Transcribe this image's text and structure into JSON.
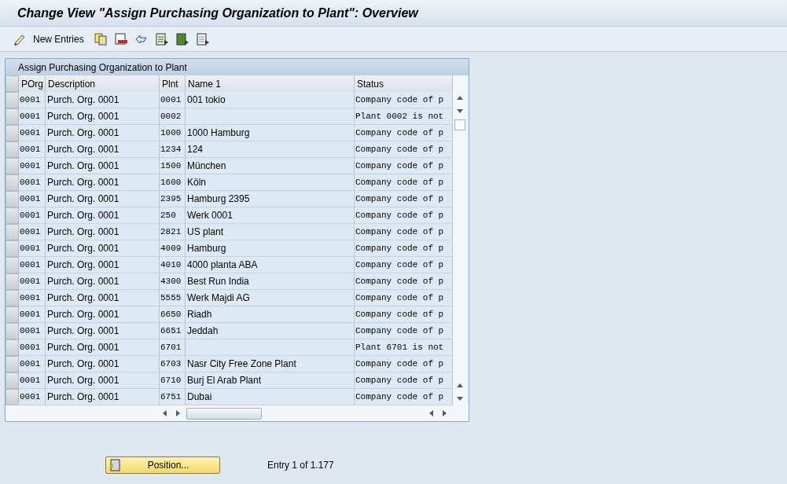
{
  "window": {
    "title": "Change View \"Assign Purchasing Organization to Plant\": Overview"
  },
  "toolbar": {
    "new_entries": "New Entries"
  },
  "table": {
    "title": "Assign Purchasing Organization to Plant",
    "columns": [
      "POrg",
      "Description",
      "Plnt",
      "Name 1",
      "Status"
    ],
    "rows": [
      {
        "porg": "0001",
        "description": "Purch. Org. 0001",
        "plant": "0001",
        "name": "001 tokio",
        "status": "Company code of p"
      },
      {
        "porg": "0001",
        "description": "Purch. Org. 0001",
        "plant": "0002",
        "name": "",
        "status": "Plant 0002 is not"
      },
      {
        "porg": "0001",
        "description": "Purch. Org. 0001",
        "plant": "1000",
        "name": "1000 Hamburg",
        "status": "Company code of p"
      },
      {
        "porg": "0001",
        "description": "Purch. Org. 0001",
        "plant": "1234",
        "name": "124",
        "status": "Company code of p"
      },
      {
        "porg": "0001",
        "description": "Purch. Org. 0001",
        "plant": "1500",
        "name": "München",
        "status": "Company code of p"
      },
      {
        "porg": "0001",
        "description": "Purch. Org. 0001",
        "plant": "1600",
        "name": "Köln",
        "status": "Company code of p"
      },
      {
        "porg": "0001",
        "description": "Purch. Org. 0001",
        "plant": "2395",
        "name": "Hamburg 2395",
        "status": "Company code of p"
      },
      {
        "porg": "0001",
        "description": "Purch. Org. 0001",
        "plant": "250",
        "name": "Werk 0001",
        "status": "Company code of p"
      },
      {
        "porg": "0001",
        "description": "Purch. Org. 0001",
        "plant": "2821",
        "name": "US plant",
        "status": "Company code of p"
      },
      {
        "porg": "0001",
        "description": "Purch. Org. 0001",
        "plant": "4009",
        "name": "Hamburg",
        "status": "Company code of p"
      },
      {
        "porg": "0001",
        "description": "Purch. Org. 0001",
        "plant": "4010",
        "name": "4000 planta ABA",
        "status": "Company code of p"
      },
      {
        "porg": "0001",
        "description": "Purch. Org. 0001",
        "plant": "4300",
        "name": "Best Run India",
        "status": "Company code of p"
      },
      {
        "porg": "0001",
        "description": "Purch. Org. 0001",
        "plant": "5555",
        "name": "Werk Majdi AG",
        "status": "Company code of p"
      },
      {
        "porg": "0001",
        "description": "Purch. Org. 0001",
        "plant": "6650",
        "name": "Riadh",
        "status": "Company code of p"
      },
      {
        "porg": "0001",
        "description": "Purch. Org. 0001",
        "plant": "6651",
        "name": "Jeddah",
        "status": "Company code of p"
      },
      {
        "porg": "0001",
        "description": "Purch. Org. 0001",
        "plant": "6701",
        "name": "",
        "status": "Plant 6701 is not"
      },
      {
        "porg": "0001",
        "description": "Purch. Org. 0001",
        "plant": "6703",
        "name": "Nasr City Free Zone Plant",
        "status": "Company code of p"
      },
      {
        "porg": "0001",
        "description": "Purch. Org. 0001",
        "plant": "6710",
        "name": "Burj El Arab Plant",
        "status": "Company code of p"
      },
      {
        "porg": "0001",
        "description": "Purch. Org. 0001",
        "plant": "6751",
        "name": "Dubai",
        "status": "Company code of p"
      }
    ]
  },
  "footer": {
    "position_button": "Position...",
    "entry_info": "Entry 1 of 1.177"
  }
}
